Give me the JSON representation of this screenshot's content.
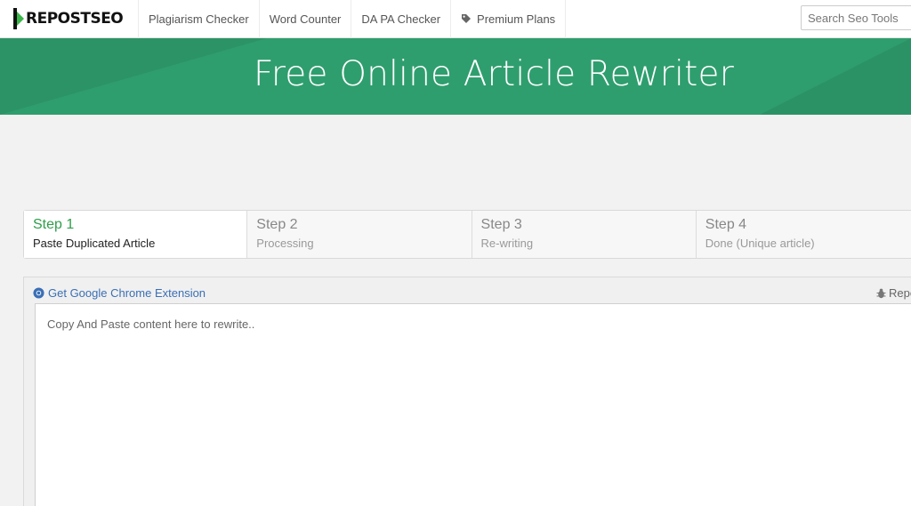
{
  "logo": {
    "text": "REPOSTSEO",
    "icon": "logo-arrow-icon",
    "colors": {
      "green": "#3cb54a",
      "dark": "#111111"
    }
  },
  "nav": {
    "items": [
      {
        "label": "Plagiarism Checker"
      },
      {
        "label": "Word Counter"
      },
      {
        "label": "DA PA Checker"
      },
      {
        "label": "Premium Plans",
        "icon": "tag-icon"
      }
    ],
    "search": {
      "placeholder": "Search Seo Tools"
    }
  },
  "banner": {
    "title": "Free Online Article Rewriter",
    "color": "#2f9e6e"
  },
  "steps": [
    {
      "title": "Step 1",
      "subtitle": "Paste Duplicated Article",
      "active": true
    },
    {
      "title": "Step 2",
      "subtitle": "Processing",
      "active": false
    },
    {
      "title": "Step 3",
      "subtitle": "Re-writing",
      "active": false
    },
    {
      "title": "Step 4",
      "subtitle": "Done (Unique article)",
      "active": false
    }
  ],
  "editor_panel": {
    "extension_link": {
      "label": "Get Google Chrome Extension",
      "icon": "chrome-icon"
    },
    "report_link": {
      "label": "Repo",
      "icon": "bug-icon"
    },
    "textarea": {
      "placeholder": "Copy And Paste content here to rewrite..",
      "value": ""
    }
  },
  "accent_colors": {
    "step_active": "#2f9e4a",
    "link": "#3a6fb5"
  }
}
